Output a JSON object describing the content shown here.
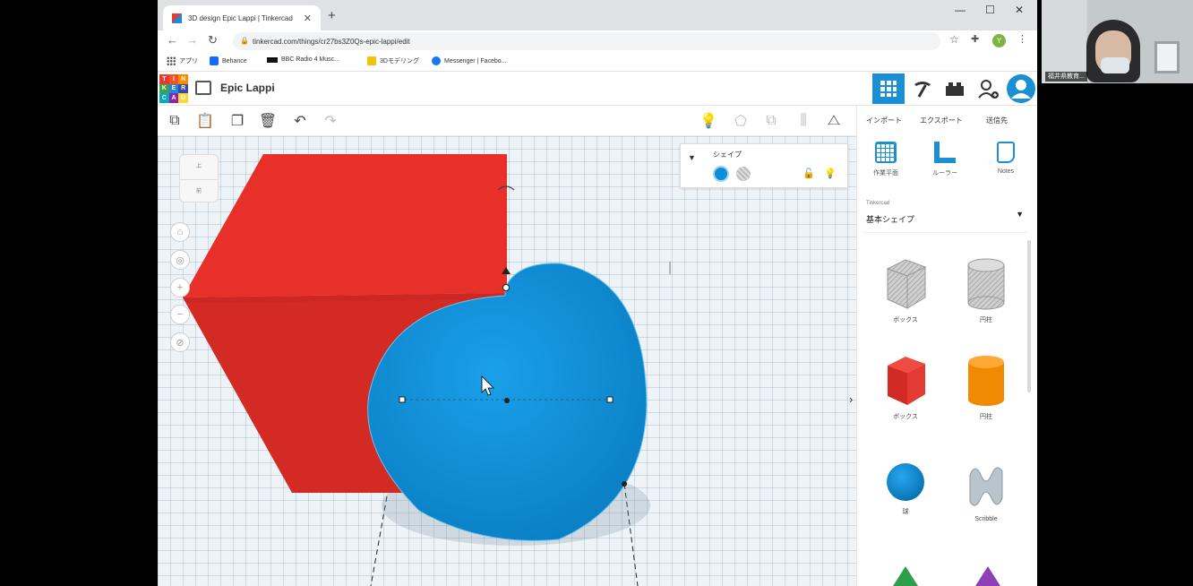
{
  "browser": {
    "tab_title": "3D design Epic Lappi | Tinkercad",
    "tab_close": "✕",
    "new_tab": "+",
    "url": "tinkercad.com/things/cr27bs3Z0Qs-epic-lappi/edit",
    "window_controls": [
      "—",
      "☐",
      "✕"
    ],
    "bookmarks": [
      {
        "label": "アプリ",
        "color": "#5f6368"
      },
      {
        "label": "Behance",
        "color": "#1769ff"
      },
      {
        "label": "BBC Radio 4 Musc...",
        "color": "#111111"
      },
      {
        "label": "3Dモデリング",
        "color": "#f4c20d"
      },
      {
        "label": "Messenger | Facebo...",
        "color": "#1877f2"
      }
    ]
  },
  "header": {
    "logo_letters": [
      "T",
      "I",
      "N",
      "K",
      "E",
      "R",
      "C",
      "A",
      "D"
    ],
    "logo_colors": [
      "#e53935",
      "#f4511e",
      "#fb8c00",
      "#43a047",
      "#1e88e5",
      "#3949ab",
      "#00acc1",
      "#8e24aa",
      "#fdd835"
    ],
    "project_name": "Epic Lappi"
  },
  "panel": {
    "tabs": [
      "インポート",
      "エクスポート",
      "送信先"
    ],
    "tools": [
      "作業平面",
      "ルーラー",
      "Notes"
    ],
    "library_source": "Tinkercad",
    "library_name": "基本シェイプ",
    "shapes": [
      {
        "label": "ボックス",
        "kind": "box-hole"
      },
      {
        "label": "円柱",
        "kind": "cyl-hole"
      },
      {
        "label": "ボックス",
        "kind": "box"
      },
      {
        "label": "円柱",
        "kind": "cyl"
      },
      {
        "label": "球",
        "kind": "sphere"
      },
      {
        "label": "Scribble",
        "kind": "scribble"
      }
    ]
  },
  "inspector": {
    "title": "シェイプ"
  },
  "viewcube": {
    "top": "上",
    "front": "前"
  },
  "colors": {
    "box_red": "#e8302a",
    "sphere_blue": "#0b8fd8",
    "accent_blue": "#1a8fd1",
    "cylinder_orange": "#f08a00"
  },
  "webcam": {
    "name_label": "福井県教育..."
  }
}
